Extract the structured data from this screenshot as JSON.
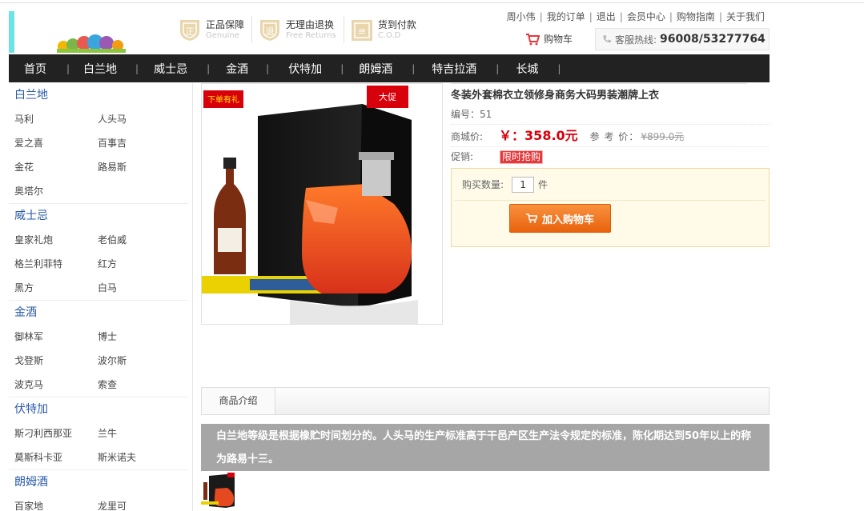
{
  "header": {
    "promises": [
      {
        "title": "正品保障",
        "subtitle": "Genuine",
        "icon": "shield-zheng-icon",
        "glyph": "正"
      },
      {
        "title": "无理由退换",
        "subtitle": "Free Returns",
        "icon": "shield-tui-icon",
        "glyph": "退"
      },
      {
        "title": "货到付款",
        "subtitle": "C.O.D",
        "icon": "box-icon",
        "glyph": "≡"
      }
    ],
    "top_links": [
      "周小伟",
      "我的订单",
      "退出",
      "会员中心",
      "购物指南",
      "关于我们"
    ],
    "top_link_separators": [
      "|",
      "|",
      "|",
      "|",
      "|"
    ],
    "cart_label": "购物车",
    "hotline_label": "客服热线:",
    "hotline_number": "96008/53277764"
  },
  "nav": {
    "items": [
      "首页",
      "白兰地",
      "威士忌",
      "金酒",
      "伏特加",
      "朗姆酒",
      "特吉拉酒",
      "长城"
    ],
    "separator": "|"
  },
  "sidebar": {
    "categories": [
      {
        "title": "白兰地",
        "items": [
          "马利",
          "人头马",
          "爱之喜",
          "百事吉",
          "金花",
          "路易斯",
          "奥塔尔"
        ]
      },
      {
        "title": "威士忌",
        "items": [
          "皇家礼炮",
          "老伯威",
          "格兰利菲特",
          "红方",
          "黑方",
          "白马"
        ]
      },
      {
        "title": "金酒",
        "items": [
          "御林军",
          "博士",
          "戈登斯",
          "波尔斯",
          "波克马",
          "索查"
        ]
      },
      {
        "title": "伏特加",
        "items": [
          "斯刁利西那亚",
          "兰牛",
          "莫斯科卡亚",
          "斯米诺夫"
        ]
      },
      {
        "title": "朗姆酒",
        "items": [
          "百家地",
          "龙里可"
        ]
      }
    ]
  },
  "product": {
    "title": "冬装外套棉衣立领修身商务大码男装潮牌上衣",
    "code_label": "编号：",
    "code": "51",
    "price_label": "商城价:",
    "price": "￥：358.0元",
    "ref_label": "参 考 价：",
    "ref_price": "¥899.0元",
    "promo_label": "促销:",
    "promo_badge": "限时抢购",
    "qty_label": "购买数量:",
    "qty_value": "1",
    "qty_unit": "件",
    "add_to_cart": "加入购物车",
    "image_badge_left": "下单有礼",
    "image_badge_right": "大促"
  },
  "tabs": [
    "商品介绍"
  ],
  "description": "白兰地等级是根据橡贮时间划分的。人头马的生产标准高于干邑产区生产法令规定的标准，陈化期达到50年以上的称为路易十三。",
  "colors": {
    "nav_bg": "#222222",
    "price_red": "#d8000b",
    "button_orange": "#f28a2e",
    "category_blue": "#2a5aa8",
    "promise_gold": "#e0c48a"
  }
}
